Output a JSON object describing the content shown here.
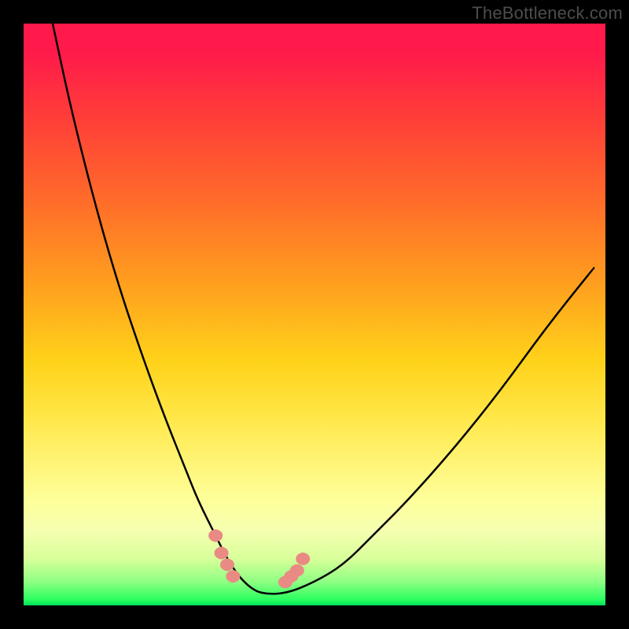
{
  "watermark": "TheBottleneck.com",
  "colors": {
    "background": "#000000",
    "gradient_top": "#ff1a4b",
    "gradient_mid": "#ffd21a",
    "gradient_bottom": "#00e05a",
    "curve": "#000000",
    "markers": "#e98a84",
    "watermark_text": "#4d4d4d"
  },
  "chart_data": {
    "type": "line",
    "title": "",
    "xlabel": "",
    "ylabel": "",
    "xlim": [
      0,
      100
    ],
    "ylim": [
      0,
      100
    ],
    "series": [
      {
        "name": "bottleneck-curve",
        "x": [
          5,
          8,
          12,
          16,
          20,
          24,
          28,
          30,
          33,
          35,
          37,
          39,
          41,
          45,
          50,
          55,
          60,
          66,
          74,
          82,
          90,
          98
        ],
        "values": [
          100,
          86,
          70,
          56,
          44,
          33,
          23,
          18,
          12,
          8,
          5,
          3,
          2,
          2,
          4,
          7,
          12,
          18,
          27,
          37,
          48,
          58
        ]
      }
    ],
    "markers": [
      {
        "x": 33,
        "y": 12
      },
      {
        "x": 34,
        "y": 9
      },
      {
        "x": 35,
        "y": 7
      },
      {
        "x": 36,
        "y": 5
      },
      {
        "x": 45,
        "y": 4
      },
      {
        "x": 46,
        "y": 5
      },
      {
        "x": 47,
        "y": 6
      },
      {
        "x": 48,
        "y": 8
      }
    ]
  }
}
